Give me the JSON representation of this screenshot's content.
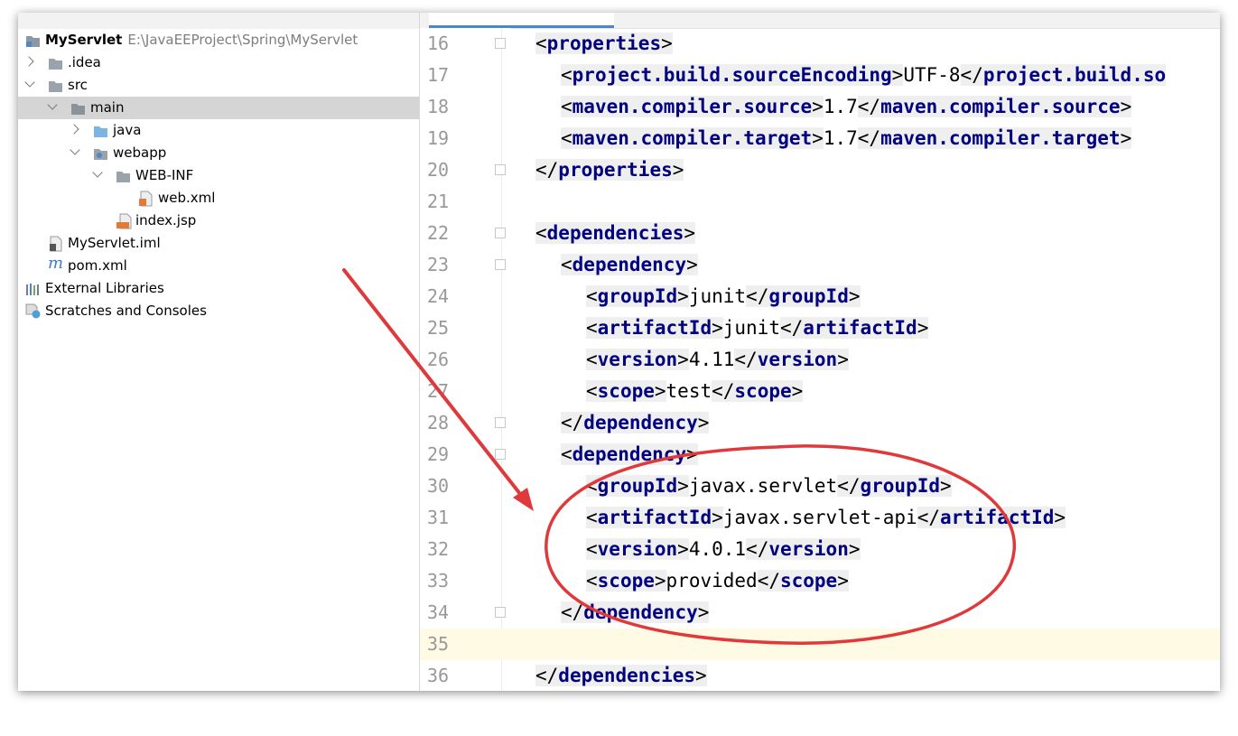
{
  "project_tree": {
    "root": {
      "name": "MyServlet",
      "path": "E:\\JavaEEProject\\Spring\\MyServlet"
    },
    "items": [
      {
        "label": ".idea",
        "icon": "folder-icon"
      },
      {
        "label": "src",
        "icon": "folder-icon"
      },
      {
        "label": "main",
        "icon": "folder-icon",
        "selected": true
      },
      {
        "label": "java",
        "icon": "source-folder-icon"
      },
      {
        "label": "webapp",
        "icon": "web-folder-icon"
      },
      {
        "label": "WEB-INF",
        "icon": "folder-icon"
      },
      {
        "label": "web.xml",
        "icon": "xml-file-icon"
      },
      {
        "label": "index.jsp",
        "icon": "jsp-file-icon"
      },
      {
        "label": "MyServlet.iml",
        "icon": "iml-file-icon"
      },
      {
        "label": "pom.xml",
        "icon": "maven-file-icon"
      },
      {
        "label": "External Libraries",
        "icon": "libraries-icon"
      },
      {
        "label": "Scratches and Consoles",
        "icon": "scratches-icon"
      }
    ]
  },
  "editor": {
    "lines": [
      {
        "num": "16",
        "tag": "properties"
      },
      {
        "num": "17",
        "tag": "project.build.sourceEncoding",
        "value": "UTF-8",
        "close_text": "</project.build.so"
      },
      {
        "num": "18",
        "tag": "maven.compiler.source",
        "value": "1.7"
      },
      {
        "num": "19",
        "tag": "maven.compiler.target",
        "value": "1.7"
      },
      {
        "num": "20",
        "tag": "properties"
      },
      {
        "num": "21"
      },
      {
        "num": "22",
        "tag": "dependencies"
      },
      {
        "num": "23",
        "tag": "dependency"
      },
      {
        "num": "24",
        "tag": "groupId",
        "value": "junit"
      },
      {
        "num": "25",
        "tag": "artifactId",
        "value": "junit"
      },
      {
        "num": "26",
        "tag": "version",
        "value": "4.11"
      },
      {
        "num": "27",
        "tag": "scope",
        "value": "test"
      },
      {
        "num": "28",
        "tag": "dependency"
      },
      {
        "num": "29",
        "tag": "dependency"
      },
      {
        "num": "30",
        "tag": "groupId",
        "value": "javax.servlet"
      },
      {
        "num": "31",
        "tag": "artifactId",
        "value": "javax.servlet-api"
      },
      {
        "num": "32",
        "tag": "version",
        "value": "4.0.1"
      },
      {
        "num": "33",
        "tag": "scope",
        "value": "provided"
      },
      {
        "num": "34",
        "tag": "dependency"
      },
      {
        "num": "35"
      },
      {
        "num": "36",
        "tag": "dependencies"
      }
    ]
  },
  "colors": {
    "tag": "#000080",
    "line_number": "#999999",
    "selected_row": "#d5d5d5",
    "current_line": "#fffae3",
    "annotation": "#e0393b"
  }
}
